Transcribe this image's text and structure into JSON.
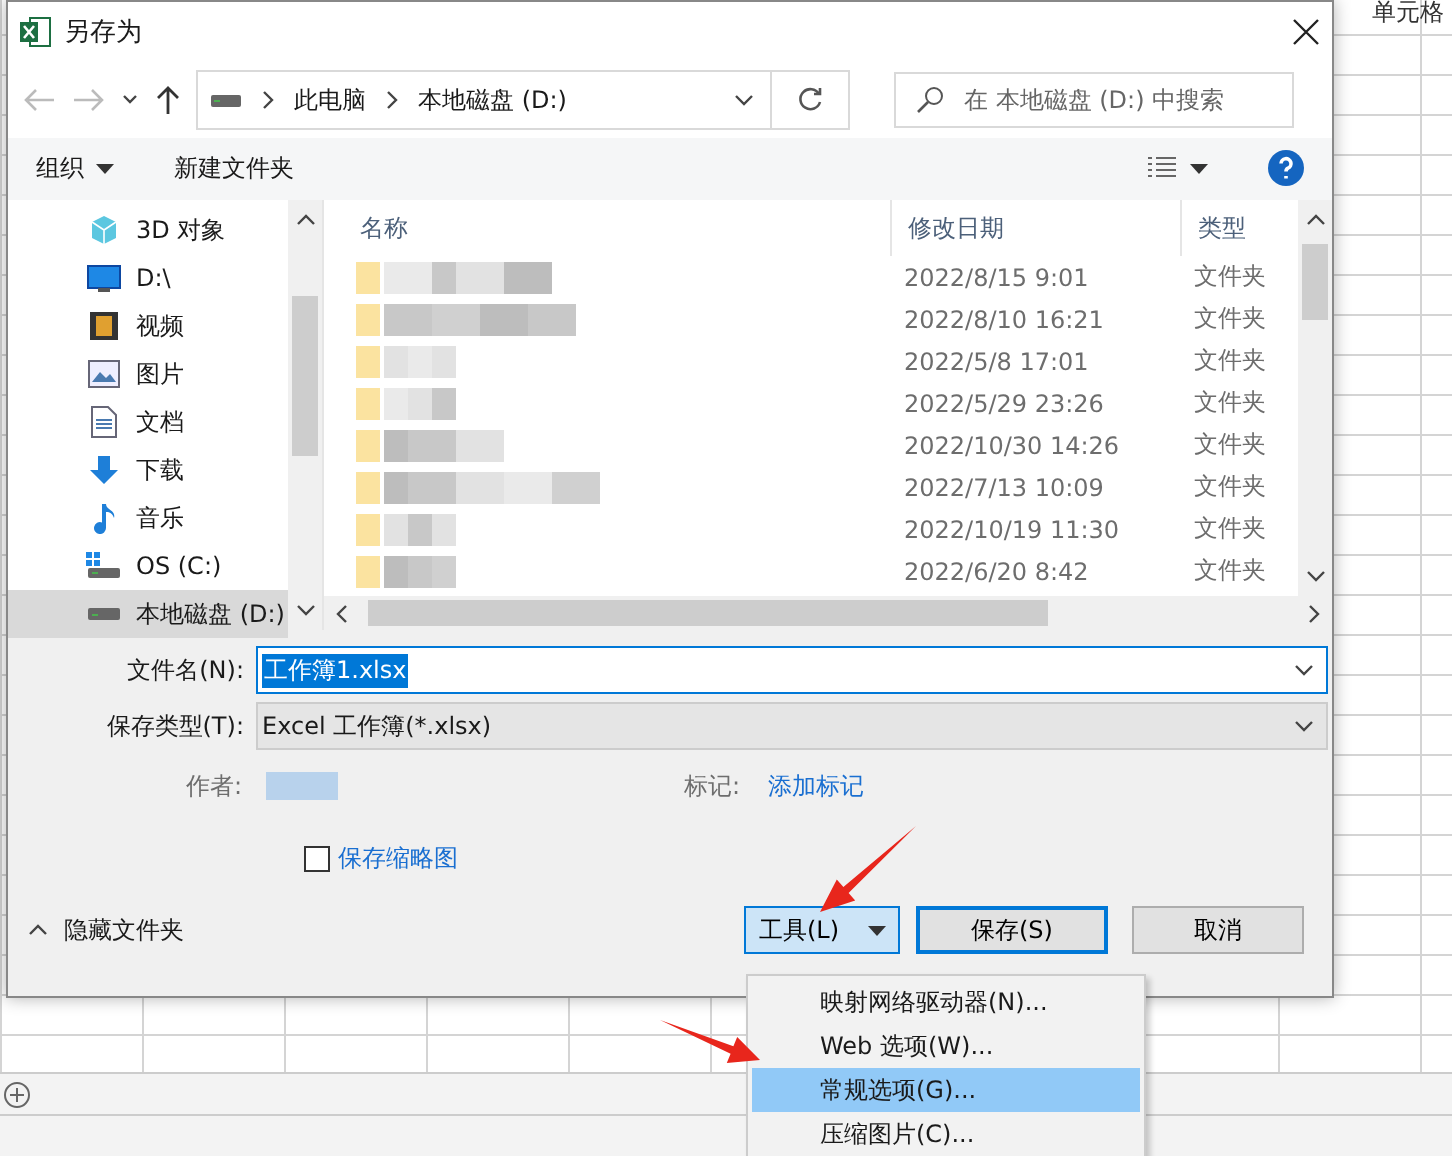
{
  "background": {
    "cell_text": "单元格"
  },
  "window": {
    "title": "另存为"
  },
  "address_bar": {
    "path": [
      "此电脑",
      "本地磁盘 (D:)"
    ]
  },
  "search": {
    "placeholder": "在 本地磁盘 (D:) 中搜索"
  },
  "toolbar": {
    "organize": "组织",
    "new_folder": "新建文件夹"
  },
  "nav_pane": {
    "items": [
      {
        "label": "3D 对象",
        "selected": false
      },
      {
        "label": "D:\\",
        "selected": false
      },
      {
        "label": "视频",
        "selected": false
      },
      {
        "label": "图片",
        "selected": false
      },
      {
        "label": "文档",
        "selected": false
      },
      {
        "label": "下载",
        "selected": false
      },
      {
        "label": "音乐",
        "selected": false
      },
      {
        "label": "OS (C:)",
        "selected": false
      },
      {
        "label": "本地磁盘 (D:)",
        "selected": true
      }
    ]
  },
  "file_list": {
    "columns": [
      "名称",
      "修改日期",
      "类型"
    ],
    "rows": [
      {
        "modified": "2022/8/15 9:01",
        "type": "文件夹"
      },
      {
        "modified": "2022/8/10 16:21",
        "type": "文件夹"
      },
      {
        "modified": "2022/5/8 17:01",
        "type": "文件夹"
      },
      {
        "modified": "2022/5/29 23:26",
        "type": "文件夹"
      },
      {
        "modified": "2022/10/30 14:26",
        "type": "文件夹"
      },
      {
        "modified": "2022/7/13 10:09",
        "type": "文件夹"
      },
      {
        "modified": "2022/10/19 11:30",
        "type": "文件夹"
      },
      {
        "modified": "2022/6/20 8:42",
        "type": "文件夹"
      }
    ]
  },
  "form": {
    "file_name": {
      "label": "文件名(N):",
      "value": "工作簿1.xlsx"
    },
    "save_type": {
      "label": "保存类型(T):",
      "value": "Excel 工作簿(*.xlsx)"
    },
    "author_label": "作者:",
    "tags_label": "标记:",
    "tags_link": "添加标记",
    "thumbnail": {
      "label": "保存缩略图",
      "checked": false
    }
  },
  "footer": {
    "hide_folders": "隐藏文件夹",
    "buttons": [
      {
        "label": "工具(L)",
        "kind": "dropdown",
        "selected": true
      },
      {
        "label": "保存(S)",
        "kind": "default",
        "selected": false
      },
      {
        "label": "取消",
        "kind": "plain",
        "selected": false
      }
    ]
  },
  "menu": {
    "items": [
      {
        "label": "映射网络驱动器(N)...",
        "selected": false
      },
      {
        "label": "Web 选项(W)...",
        "selected": false
      },
      {
        "label": "常规选项(G)...",
        "selected": true
      },
      {
        "label": "压缩图片(C)...",
        "selected": false
      }
    ]
  }
}
